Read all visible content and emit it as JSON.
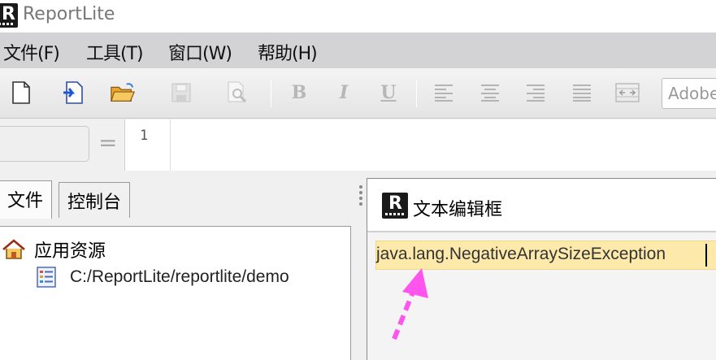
{
  "window": {
    "title": "ReportLite",
    "logo_letter": "R"
  },
  "menu": [
    {
      "label": "文件(F)"
    },
    {
      "label": "工具(T)"
    },
    {
      "label": "窗口(W)"
    },
    {
      "label": "帮助(H)"
    }
  ],
  "toolbar": {
    "bold_label": "B",
    "italic_label": "I",
    "underline_label": "U",
    "font_value": "Adobe",
    "icons": [
      "new-file-icon",
      "import-icon",
      "open-folder-icon",
      "save-icon",
      "print-preview-icon",
      "bold-icon",
      "italic-icon",
      "underline-icon",
      "align-left-icon",
      "align-center-icon",
      "align-right-icon",
      "justify-icon",
      "merge-cells-icon"
    ]
  },
  "formula_bar": {
    "equals": "=",
    "line_number": "1",
    "cell_name": ""
  },
  "left_panel": {
    "tabs": [
      {
        "label": "文件"
      },
      {
        "label": "控制台"
      }
    ],
    "tree": {
      "root_label": "应用资源",
      "children": [
        {
          "label": "C:/ReportLite/reportlite/demo"
        }
      ]
    }
  },
  "dialog": {
    "title": "文本编辑框",
    "value": "java.lang.NegativeArraySizeException",
    "highlight_color": "#fdeaaa",
    "annotation_arrow_color": "#ff55ee"
  }
}
